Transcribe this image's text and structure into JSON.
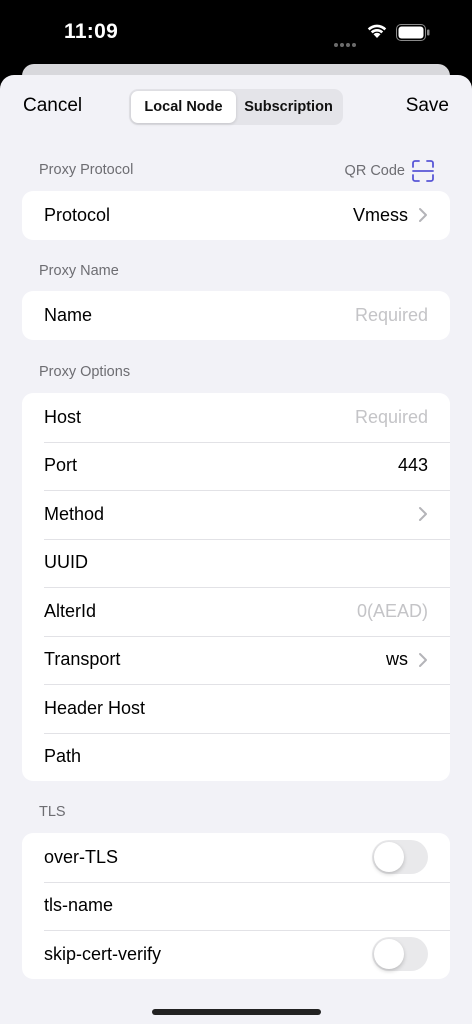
{
  "status_bar": {
    "time": "11:09"
  },
  "nav": {
    "cancel_label": "Cancel",
    "save_label": "Save",
    "segments": [
      {
        "label": "Local Node",
        "selected": true
      },
      {
        "label": "Subscription",
        "selected": false
      }
    ]
  },
  "sections": {
    "proxy_protocol": {
      "header": "Proxy Protocol",
      "qr_label": "QR Code",
      "rows": {
        "protocol": {
          "label": "Protocol",
          "value": "Vmess"
        }
      }
    },
    "proxy_name": {
      "header": "Proxy Name",
      "rows": {
        "name": {
          "label": "Name",
          "placeholder": "Required"
        }
      }
    },
    "proxy_options": {
      "header": "Proxy Options",
      "rows": {
        "host": {
          "label": "Host",
          "placeholder": "Required"
        },
        "port": {
          "label": "Port",
          "value": "443"
        },
        "method": {
          "label": "Method"
        },
        "uuid": {
          "label": "UUID"
        },
        "alterid": {
          "label": "AlterId",
          "placeholder": "0(AEAD)"
        },
        "transport": {
          "label": "Transport",
          "value": "ws"
        },
        "header_host": {
          "label": "Header Host"
        },
        "path": {
          "label": "Path"
        }
      }
    },
    "tls": {
      "header": "TLS",
      "rows": {
        "over_tls": {
          "label": "over-TLS",
          "enabled": false
        },
        "tls_name": {
          "label": "tls-name"
        },
        "skip_cert_verify": {
          "label": "skip-cert-verify",
          "enabled": false
        }
      }
    }
  },
  "colors": {
    "accent": "#5856d6",
    "background": "#f2f2f7",
    "placeholder": "#c4c4c7"
  }
}
